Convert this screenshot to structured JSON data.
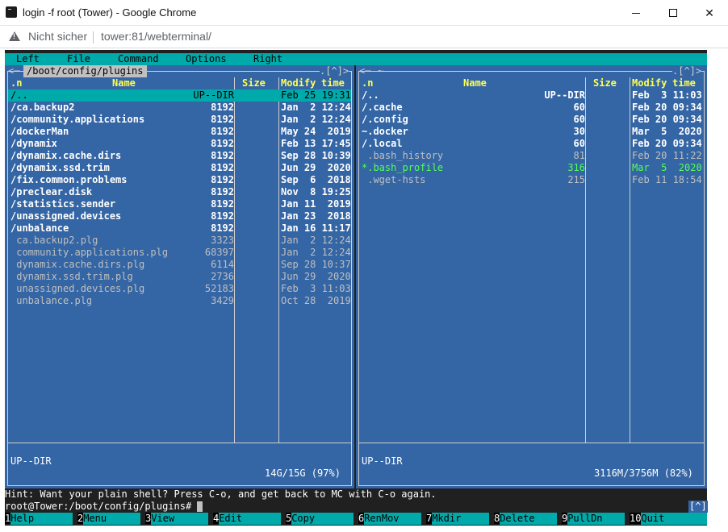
{
  "window": {
    "title": "login -f root (Tower) - Google Chrome"
  },
  "addressbar": {
    "security_text": "Nicht sicher",
    "url": "tower:81/webterminal/"
  },
  "mc": {
    "menu": [
      "Left",
      "File",
      "Command",
      "Options",
      "Right"
    ],
    "left_panel": {
      "path": "/boot/config/plugins",
      "corner": ".[^]>",
      "headers": {
        "name_short": ".n",
        "name": "Name",
        "size": "Size",
        "modify": "Modify",
        "time": "time"
      },
      "entries": [
        {
          "name": "/..",
          "size": "UP--DIR",
          "date": "Feb 25 19:31",
          "type": "selected"
        },
        {
          "name": "/ca.backup2",
          "size": "8192",
          "date": "Jan  2 12:24",
          "type": "dir"
        },
        {
          "name": "/community.applications",
          "size": "8192",
          "date": "Jan  2 12:24",
          "type": "dir"
        },
        {
          "name": "/dockerMan",
          "size": "8192",
          "date": "May 24  2019",
          "type": "dir"
        },
        {
          "name": "/dynamix",
          "size": "8192",
          "date": "Feb 13 17:45",
          "type": "dir"
        },
        {
          "name": "/dynamix.cache.dirs",
          "size": "8192",
          "date": "Sep 28 10:39",
          "type": "dir"
        },
        {
          "name": "/dynamix.ssd.trim",
          "size": "8192",
          "date": "Jun 29  2020",
          "type": "dir"
        },
        {
          "name": "/fix.common.problems",
          "size": "8192",
          "date": "Sep  6  2018",
          "type": "dir"
        },
        {
          "name": "/preclear.disk",
          "size": "8192",
          "date": "Nov  8 19:25",
          "type": "dir"
        },
        {
          "name": "/statistics.sender",
          "size": "8192",
          "date": "Jan 11  2019",
          "type": "dir"
        },
        {
          "name": "/unassigned.devices",
          "size": "8192",
          "date": "Jan 23  2018",
          "type": "dir"
        },
        {
          "name": "/unbalance",
          "size": "8192",
          "date": "Jan 16 11:17",
          "type": "dir"
        },
        {
          "name": " ca.backup2.plg",
          "size": "3323",
          "date": "Jan  2 12:24",
          "type": "file"
        },
        {
          "name": " community.applications.plg",
          "size": "68397",
          "date": "Jan  2 12:24",
          "type": "file"
        },
        {
          "name": " dynamix.cache.dirs.plg",
          "size": "6114",
          "date": "Sep 28 10:37",
          "type": "file"
        },
        {
          "name": " dynamix.ssd.trim.plg",
          "size": "2736",
          "date": "Jun 29  2020",
          "type": "file"
        },
        {
          "name": " unassigned.devices.plg",
          "size": "52183",
          "date": "Feb  3 11:03",
          "type": "file"
        },
        {
          "name": " unbalance.plg",
          "size": "3429",
          "date": "Oct 28  2019",
          "type": "file"
        }
      ],
      "status": "UP--DIR",
      "usage": "14G/15G (97%)"
    },
    "right_panel": {
      "path": "~",
      "corner": ".[^]>",
      "headers": {
        "name_short": ".n",
        "name": "Name",
        "size": "Size",
        "modify": "Modify",
        "time": "time"
      },
      "entries": [
        {
          "name": "/..",
          "size": "UP--DIR",
          "date": "Feb  3 11:03",
          "type": "dir"
        },
        {
          "name": "/.cache",
          "size": "60",
          "date": "Feb 20 09:34",
          "type": "dir"
        },
        {
          "name": "/.config",
          "size": "60",
          "date": "Feb 20 09:34",
          "type": "dir"
        },
        {
          "name": "~.docker",
          "size": "30",
          "date": "Mar  5  2020",
          "type": "dir"
        },
        {
          "name": "/.local",
          "size": "60",
          "date": "Feb 20 09:34",
          "type": "dir"
        },
        {
          "name": " .bash_history",
          "size": "81",
          "date": "Feb 20 11:22",
          "type": "file"
        },
        {
          "name": "*.bash_profile",
          "size": "316",
          "date": "Mar  5  2020",
          "type": "exec"
        },
        {
          "name": " .wget-hsts",
          "size": "215",
          "date": "Feb 11 18:54",
          "type": "file"
        }
      ],
      "status": "UP--DIR",
      "usage": "3116M/3756M (82%)"
    },
    "hint": "Hint: Want your plain shell? Press C-o, and get back to MC with C-o again.",
    "prompt": "root@Tower:/boot/config/plugins#",
    "scroll_badge": "[^]",
    "fkeys": [
      {
        "num": "1",
        "label": "Help"
      },
      {
        "num": "2",
        "label": "Menu"
      },
      {
        "num": "3",
        "label": "View"
      },
      {
        "num": "4",
        "label": "Edit"
      },
      {
        "num": "5",
        "label": "Copy"
      },
      {
        "num": "6",
        "label": "RenMov"
      },
      {
        "num": "7",
        "label": "Mkdir"
      },
      {
        "num": "8",
        "label": "Delete"
      },
      {
        "num": "9",
        "label": "PullDn"
      },
      {
        "num": "10",
        "label": "Quit"
      }
    ]
  },
  "colors": {
    "panel_bg": "#3465a4",
    "menubar_bg": "#00aaaa",
    "header_fg": "#ffff55",
    "exec_fg": "#55ff55",
    "terminal_bg": "#202020"
  }
}
